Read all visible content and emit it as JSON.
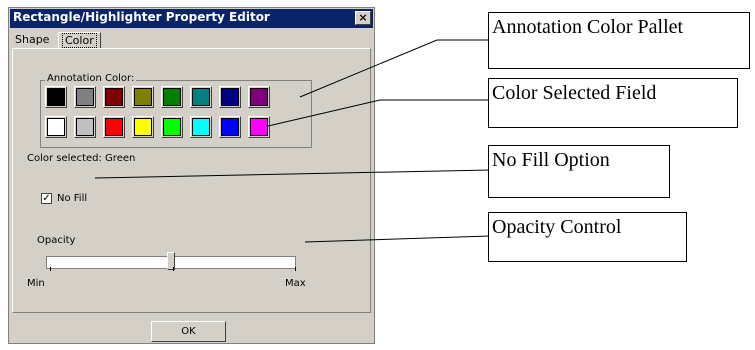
{
  "dialog": {
    "title": "Rectangle/Highlighter Property Editor",
    "close_glyph": "×",
    "tabs": [
      "Shape",
      "Color"
    ],
    "group_label": "Annotation Color:",
    "swatches": [
      "#000000",
      "#808080",
      "#800000",
      "#808000",
      "#008000",
      "#008080",
      "#000080",
      "#800080",
      "#ffffff",
      "#c0c0c0",
      "#ff0000",
      "#ffff00",
      "#00ff00",
      "#00ffff",
      "#0000ff",
      "#ff00ff"
    ],
    "color_selected": "Color selected: Green",
    "no_fill_label": "No Fill",
    "no_fill_checked": "✓",
    "opacity_label": "Opacity",
    "opacity_value": 0.5,
    "min_label": "Min",
    "max_label": "Max",
    "ok_label": "OK"
  },
  "callouts": {
    "pallet": "Annotation Color Pallet",
    "selected": "Color Selected Field",
    "nofill": "No Fill Option",
    "opacity": "Opacity Control"
  }
}
